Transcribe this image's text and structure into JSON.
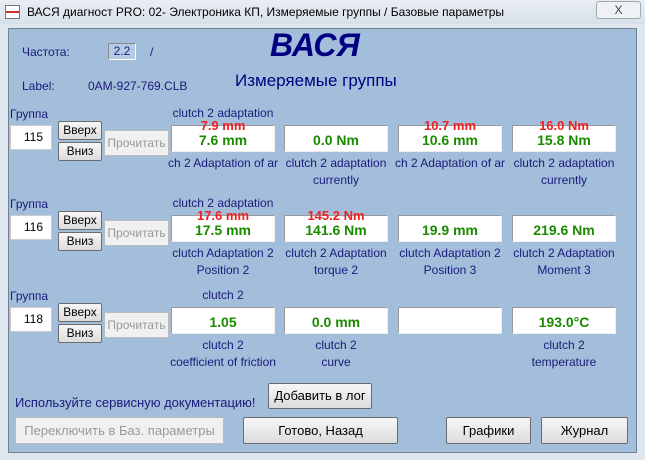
{
  "window": {
    "title": "ВАСЯ диагност PRO: 02- Электроника КП,  Измеряемые группы / Базовые параметры",
    "close_label": "X"
  },
  "header": {
    "freq_label": "Частота:",
    "freq_value": "2.2",
    "freq_slash": "/",
    "label_label": "Label:",
    "label_value": "0AM-927-769.CLB",
    "logo": "ВАСЯ",
    "subtitle": "Измеряемые группы"
  },
  "groups": [
    {
      "label": "Группа",
      "number": "115",
      "up": "Вверх",
      "down": "Вниз",
      "read": "Прочитать",
      "cells": [
        {
          "top": "clutch 2 adaptation",
          "red": "7.9 mm",
          "value": "7.6 mm",
          "desc1": "ch 2 Adaptation of ar",
          "desc2": ""
        },
        {
          "top": "",
          "red": "",
          "value": "0.0 Nm",
          "desc1": "clutch 2 adaptation",
          "desc2": "currently"
        },
        {
          "top": "",
          "red": "10.7 mm",
          "value": "10.6 mm",
          "desc1": "ch 2 Adaptation of ar",
          "desc2": ""
        },
        {
          "top": "",
          "red": "16.0 Nm",
          "value": "15.8 Nm",
          "desc1": "clutch 2 adaptation",
          "desc2": "currently"
        }
      ]
    },
    {
      "label": "Группа",
      "number": "116",
      "up": "Вверх",
      "down": "Вниз",
      "read": "Прочитать",
      "cells": [
        {
          "top": "clutch 2 adaptation",
          "red": "17.6 mm",
          "value": "17.5 mm",
          "desc1": "clutch Adaptation 2",
          "desc2": "Position 2"
        },
        {
          "top": "",
          "red": "145.2 Nm",
          "value": "141.6 Nm",
          "desc1": "clutch 2 Adaptation",
          "desc2": "torque 2"
        },
        {
          "top": "",
          "red": "",
          "value": "19.9 mm",
          "desc1": "clutch Adaptation 2",
          "desc2": "Position 3"
        },
        {
          "top": "",
          "red": "",
          "value": "219.6 Nm",
          "desc1": "clutch 2 Adaptation",
          "desc2": "Moment 3"
        }
      ]
    },
    {
      "label": "Группа",
      "number": "118",
      "up": "Вверх",
      "down": "Вниз",
      "read": "Прочитать",
      "cells": [
        {
          "top": "clutch 2",
          "red": "",
          "value": "1.05",
          "desc1": "clutch 2",
          "desc2": "coefficient of friction"
        },
        {
          "top": "",
          "red": "",
          "value": "0.0 mm",
          "desc1": "clutch 2",
          "desc2": "curve"
        },
        {
          "top": "",
          "red": "",
          "value": "",
          "desc1": "",
          "desc2": ""
        },
        {
          "top": "",
          "red": "",
          "value": "193.0°C",
          "desc1": "clutch 2",
          "desc2": "temperature"
        }
      ]
    }
  ],
  "footer": {
    "hint": "Используйте сервисную документацию!",
    "add_log": "Добавить в лог",
    "switch_basic": "Переключить в Баз. параметры",
    "done_back": "Готово, Назад",
    "graphs": "Графики",
    "journal": "Журнал"
  }
}
